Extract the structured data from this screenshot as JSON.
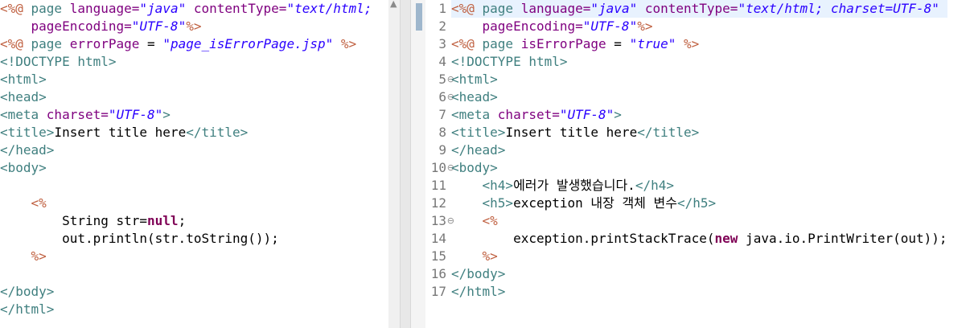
{
  "colors": {
    "directive": "#bf5f3f",
    "tag": "#3f7f7f",
    "attribute": "#7f007f",
    "value": "#2a00ff",
    "java_keyword": "#7f0055",
    "plain": "#000000",
    "line_number": "#787878",
    "current_line": "#e8f2fe"
  },
  "icons": {
    "scroll_up": "▲",
    "fold": "⊖"
  },
  "left_editor": {
    "lines": [
      [
        {
          "c": "dir",
          "t": "<%@ "
        },
        {
          "c": "kw",
          "t": "page "
        },
        {
          "c": "attr",
          "t": "language="
        },
        {
          "c": "val",
          "t": "\"java\""
        },
        {
          "c": "pl",
          "t": " "
        },
        {
          "c": "attr",
          "t": "contentType="
        },
        {
          "c": "val",
          "t": "\"text/html;"
        }
      ],
      [
        {
          "c": "pl",
          "t": "    "
        },
        {
          "c": "attr",
          "t": "pageEncoding="
        },
        {
          "c": "val",
          "t": "\"UTF-8\""
        },
        {
          "c": "dir",
          "t": "%>"
        }
      ],
      [
        {
          "c": "dir",
          "t": "<%@ "
        },
        {
          "c": "kw",
          "t": "page "
        },
        {
          "c": "attr",
          "t": "errorPage"
        },
        {
          "c": "pl",
          "t": " = "
        },
        {
          "c": "val",
          "t": "\"page_isErrorPage.jsp\""
        },
        {
          "c": "pl",
          "t": " "
        },
        {
          "c": "dir",
          "t": "%>"
        }
      ],
      [
        {
          "c": "kw",
          "t": "<!DOCTYPE html>"
        }
      ],
      [
        {
          "c": "kw",
          "t": "<html>"
        }
      ],
      [
        {
          "c": "kw",
          "t": "<head>"
        }
      ],
      [
        {
          "c": "kw",
          "t": "<meta "
        },
        {
          "c": "attr",
          "t": "charset="
        },
        {
          "c": "val",
          "t": "\"UTF-8\""
        },
        {
          "c": "kw",
          "t": ">"
        }
      ],
      [
        {
          "c": "kw",
          "t": "<title>"
        },
        {
          "c": "pl",
          "t": "Insert title here"
        },
        {
          "c": "kw",
          "t": "</title>"
        }
      ],
      [
        {
          "c": "kw",
          "t": "</head>"
        }
      ],
      [
        {
          "c": "kw",
          "t": "<body>"
        }
      ],
      [],
      [
        {
          "c": "pl",
          "t": "    "
        },
        {
          "c": "dir",
          "t": "<%"
        }
      ],
      [
        {
          "c": "pl",
          "t": "        String str="
        },
        {
          "c": "jkw",
          "t": "null"
        },
        {
          "c": "pl",
          "t": ";"
        }
      ],
      [
        {
          "c": "pl",
          "t": "        out.println(str.toString());"
        }
      ],
      [
        {
          "c": "pl",
          "t": "    "
        },
        {
          "c": "dir",
          "t": "%>"
        }
      ],
      [],
      [
        {
          "c": "kw",
          "t": "</body>"
        }
      ],
      [
        {
          "c": "kw",
          "t": "</html>"
        }
      ]
    ]
  },
  "right_editor": {
    "current_line": 1,
    "folds": [
      5,
      6,
      10,
      13
    ],
    "lines": [
      [
        {
          "c": "dir",
          "t": "<%@ "
        },
        {
          "c": "kw",
          "t": "page "
        },
        {
          "c": "attr",
          "t": "language="
        },
        {
          "c": "val",
          "t": "\"java\""
        },
        {
          "c": "pl",
          "t": " "
        },
        {
          "c": "attr",
          "t": "contentType="
        },
        {
          "c": "val",
          "t": "\"text/html; charset=UTF-8\""
        }
      ],
      [
        {
          "c": "pl",
          "t": "    "
        },
        {
          "c": "attr",
          "t": "pageEncoding="
        },
        {
          "c": "val",
          "t": "\"UTF-8\""
        },
        {
          "c": "dir",
          "t": "%>"
        }
      ],
      [
        {
          "c": "dir",
          "t": "<%@ "
        },
        {
          "c": "kw",
          "t": "page "
        },
        {
          "c": "attr",
          "t": "isErrorPage"
        },
        {
          "c": "pl",
          "t": " = "
        },
        {
          "c": "val",
          "t": "\"true\""
        },
        {
          "c": "pl",
          "t": " "
        },
        {
          "c": "dir",
          "t": "%>"
        }
      ],
      [
        {
          "c": "kw",
          "t": "<!DOCTYPE html>"
        }
      ],
      [
        {
          "c": "kw",
          "t": "<html>"
        }
      ],
      [
        {
          "c": "kw",
          "t": "<head>"
        }
      ],
      [
        {
          "c": "kw",
          "t": "<meta "
        },
        {
          "c": "attr",
          "t": "charset="
        },
        {
          "c": "val",
          "t": "\"UTF-8\""
        },
        {
          "c": "kw",
          "t": ">"
        }
      ],
      [
        {
          "c": "kw",
          "t": "<title>"
        },
        {
          "c": "pl",
          "t": "Insert title here"
        },
        {
          "c": "kw",
          "t": "</title>"
        }
      ],
      [
        {
          "c": "kw",
          "t": "</head>"
        }
      ],
      [
        {
          "c": "kw",
          "t": "<body>"
        }
      ],
      [
        {
          "c": "pl",
          "t": "    "
        },
        {
          "c": "kw",
          "t": "<h4>"
        },
        {
          "c": "pl",
          "t": "에러가 발생했습니다."
        },
        {
          "c": "kw",
          "t": "</h4>"
        }
      ],
      [
        {
          "c": "pl",
          "t": "    "
        },
        {
          "c": "kw",
          "t": "<h5>"
        },
        {
          "c": "pl",
          "t": "exception 내장 객체 변수"
        },
        {
          "c": "kw",
          "t": "</h5>"
        }
      ],
      [
        {
          "c": "pl",
          "t": "    "
        },
        {
          "c": "dir",
          "t": "<%"
        }
      ],
      [
        {
          "c": "pl",
          "t": "        exception.printStackTrace("
        },
        {
          "c": "jkw",
          "t": "new"
        },
        {
          "c": "pl",
          "t": " java.io.PrintWriter(out));"
        }
      ],
      [
        {
          "c": "pl",
          "t": "    "
        },
        {
          "c": "dir",
          "t": "%>"
        }
      ],
      [
        {
          "c": "kw",
          "t": "</body>"
        }
      ],
      [
        {
          "c": "kw",
          "t": "</html>"
        }
      ]
    ]
  }
}
